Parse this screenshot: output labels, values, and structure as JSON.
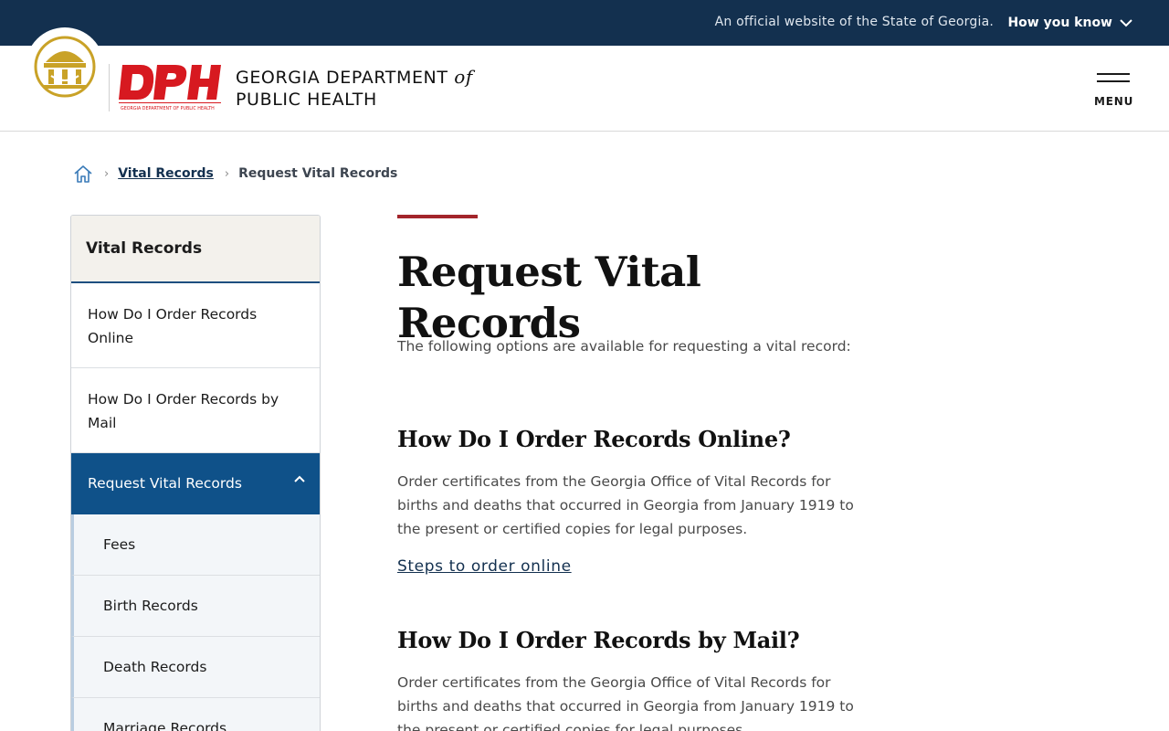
{
  "gov_banner": {
    "official_text": "An official website of the State of Georgia.",
    "how_you_know": "How you know",
    "icon": "chevron-down-icon"
  },
  "header": {
    "seal_icon": "georgia-state-seal",
    "logo_text": "DPH",
    "logo_subtext": "GEORGIA DEPARTMENT OF PUBLIC HEALTH",
    "org_line1": "GEORGIA DEPARTMENT",
    "org_of": "of",
    "org_line2": "PUBLIC HEALTH",
    "menu_label": "MENU",
    "menu_icon": "hamburger-icon"
  },
  "breadcrumb": {
    "home_icon": "home-icon",
    "items": [
      {
        "label": "Vital Records"
      },
      {
        "label": "Request Vital Records"
      }
    ]
  },
  "sidebar": {
    "title": "Vital Records",
    "items": [
      {
        "label": "How Do I Order Records Online"
      },
      {
        "label": "How Do I Order Records by Mail"
      },
      {
        "label": "Request Vital Records",
        "active": true
      }
    ],
    "subitems": [
      {
        "label": "Fees"
      },
      {
        "label": "Birth Records"
      },
      {
        "label": "Death Records"
      },
      {
        "label": "Marriage Records"
      }
    ],
    "colors": {
      "active_bg": "#0f5189",
      "heading_bg": "#f3f1ec"
    }
  },
  "main": {
    "title": "Request Vital Records",
    "intro": "The following options are available for requesting a vital record:",
    "sections": [
      {
        "heading": "How Do I Order Records Online?",
        "body": "Order certificates from the Georgia Office of Vital Records for births and deaths that occurred in Georgia from January 1919 to the present or certified copies for legal purposes.",
        "link": "Steps to order online"
      },
      {
        "heading": "How Do I Order Records by Mail?",
        "body": "Order certificates from the Georgia Office of Vital Records for births and deaths that occurred in Georgia from January 1919 to the present or certified copies for legal purposes."
      }
    ]
  },
  "colors": {
    "gov_bar": "#13304f",
    "accent_red": "#a3252b",
    "link_navy": "#13304f",
    "logo_red": "#d71920",
    "seal_gold": "#c9a227"
  }
}
